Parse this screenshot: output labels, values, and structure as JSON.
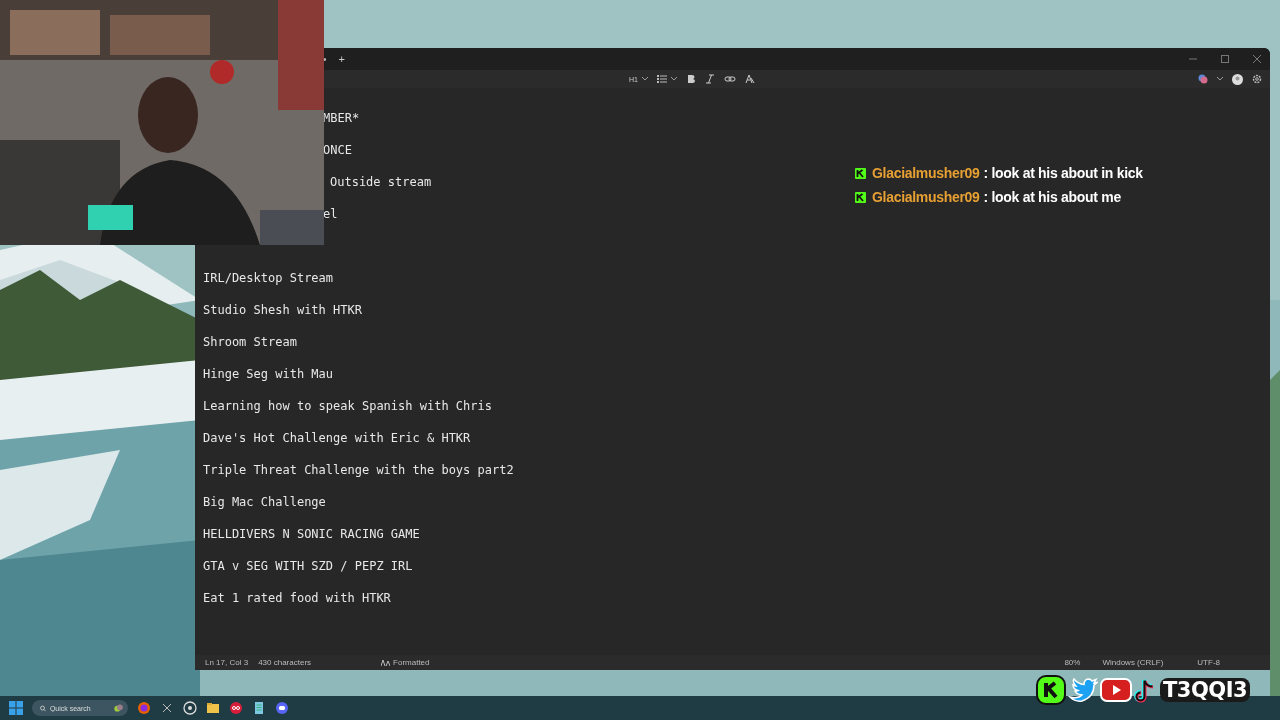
{
  "notepad": {
    "tab_marker": "•",
    "new_tab": "+",
    "toolbar": [
      {
        "kind": "heading",
        "label": "H1"
      },
      {
        "kind": "list"
      },
      {
        "kind": "bold"
      },
      {
        "kind": "italic"
      },
      {
        "kind": "link"
      },
      {
        "kind": "clear"
      }
    ],
    "covered_lines": [
      "MBER*",
      "ONCE",
      "Outside stream",
      "el"
    ],
    "lines": [
      "IRL/Desktop Stream",
      "Studio Shesh with HTKR",
      "Shroom Stream",
      "Hinge Seg with Mau",
      "Learning how to speak Spanish with Chris",
      "Dave's Hot Challenge with Eric & HTKR",
      "Triple Threat Challenge with the boys part2",
      "Big Mac Challenge",
      "HELLDIVERS N SONIC RACING GAME",
      "GTA v SEG WITH SZD / PEPZ IRL",
      "Eat 1 rated food with HTKR"
    ],
    "status_bar": {
      "position": "Ln 17, Col 3",
      "characters": "430 characters",
      "format": "Formatted",
      "zoom": "80%",
      "line_endings": "Windows (CRLF)",
      "encoding": "UTF-8"
    }
  },
  "chat": [
    {
      "user": "Glacialmusher09",
      "message": ": look at his about in kick"
    },
    {
      "user": "Glacialmusher09",
      "message": ": look at his about me"
    }
  ],
  "social": {
    "handle": "T3QQI3"
  },
  "taskbar": {
    "search_placeholder": "Quick search"
  }
}
